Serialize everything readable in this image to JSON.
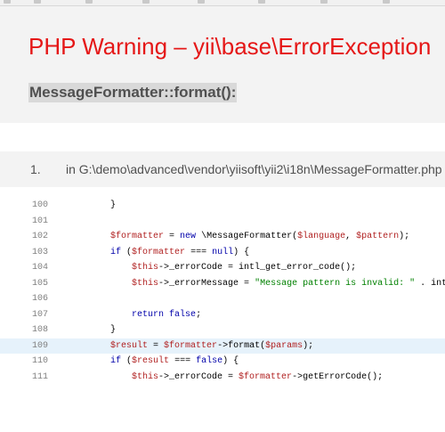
{
  "bookmarks": [
    "",
    "",
    "",
    "",
    "",
    "",
    "",
    ""
  ],
  "header": {
    "title": "PHP Warning – yii\\base\\ErrorException",
    "message": "MessageFormatter::format():"
  },
  "trace": {
    "number": "1.",
    "file": "in G:\\demo\\advanced\\vendor\\yiisoft\\yii2\\i18n\\MessageFormatter.php"
  },
  "code": {
    "lines": [
      {
        "num": "100",
        "text": "        }"
      },
      {
        "num": "101",
        "text": ""
      },
      {
        "num": "102",
        "text": "        $formatter = new \\MessageFormatter($language, $pattern);"
      },
      {
        "num": "103",
        "text": "        if ($formatter === null) {"
      },
      {
        "num": "104",
        "text": "            $this->_errorCode = intl_get_error_code();"
      },
      {
        "num": "105",
        "text": "            $this->_errorMessage = \"Message pattern is invalid: \" . intl_"
      },
      {
        "num": "106",
        "text": ""
      },
      {
        "num": "107",
        "text": "            return false;"
      },
      {
        "num": "108",
        "text": "        }"
      },
      {
        "num": "109",
        "text": "        $result = $formatter->format($params);"
      },
      {
        "num": "110",
        "text": "        if ($result === false) {"
      },
      {
        "num": "111",
        "text": "            $this->_errorCode = $formatter->getErrorCode();"
      }
    ],
    "highlighted_line": "109"
  },
  "colors": {
    "title": "#e51717",
    "header_bg": "#f3f3f3",
    "highlight": "#e6f2fb"
  }
}
